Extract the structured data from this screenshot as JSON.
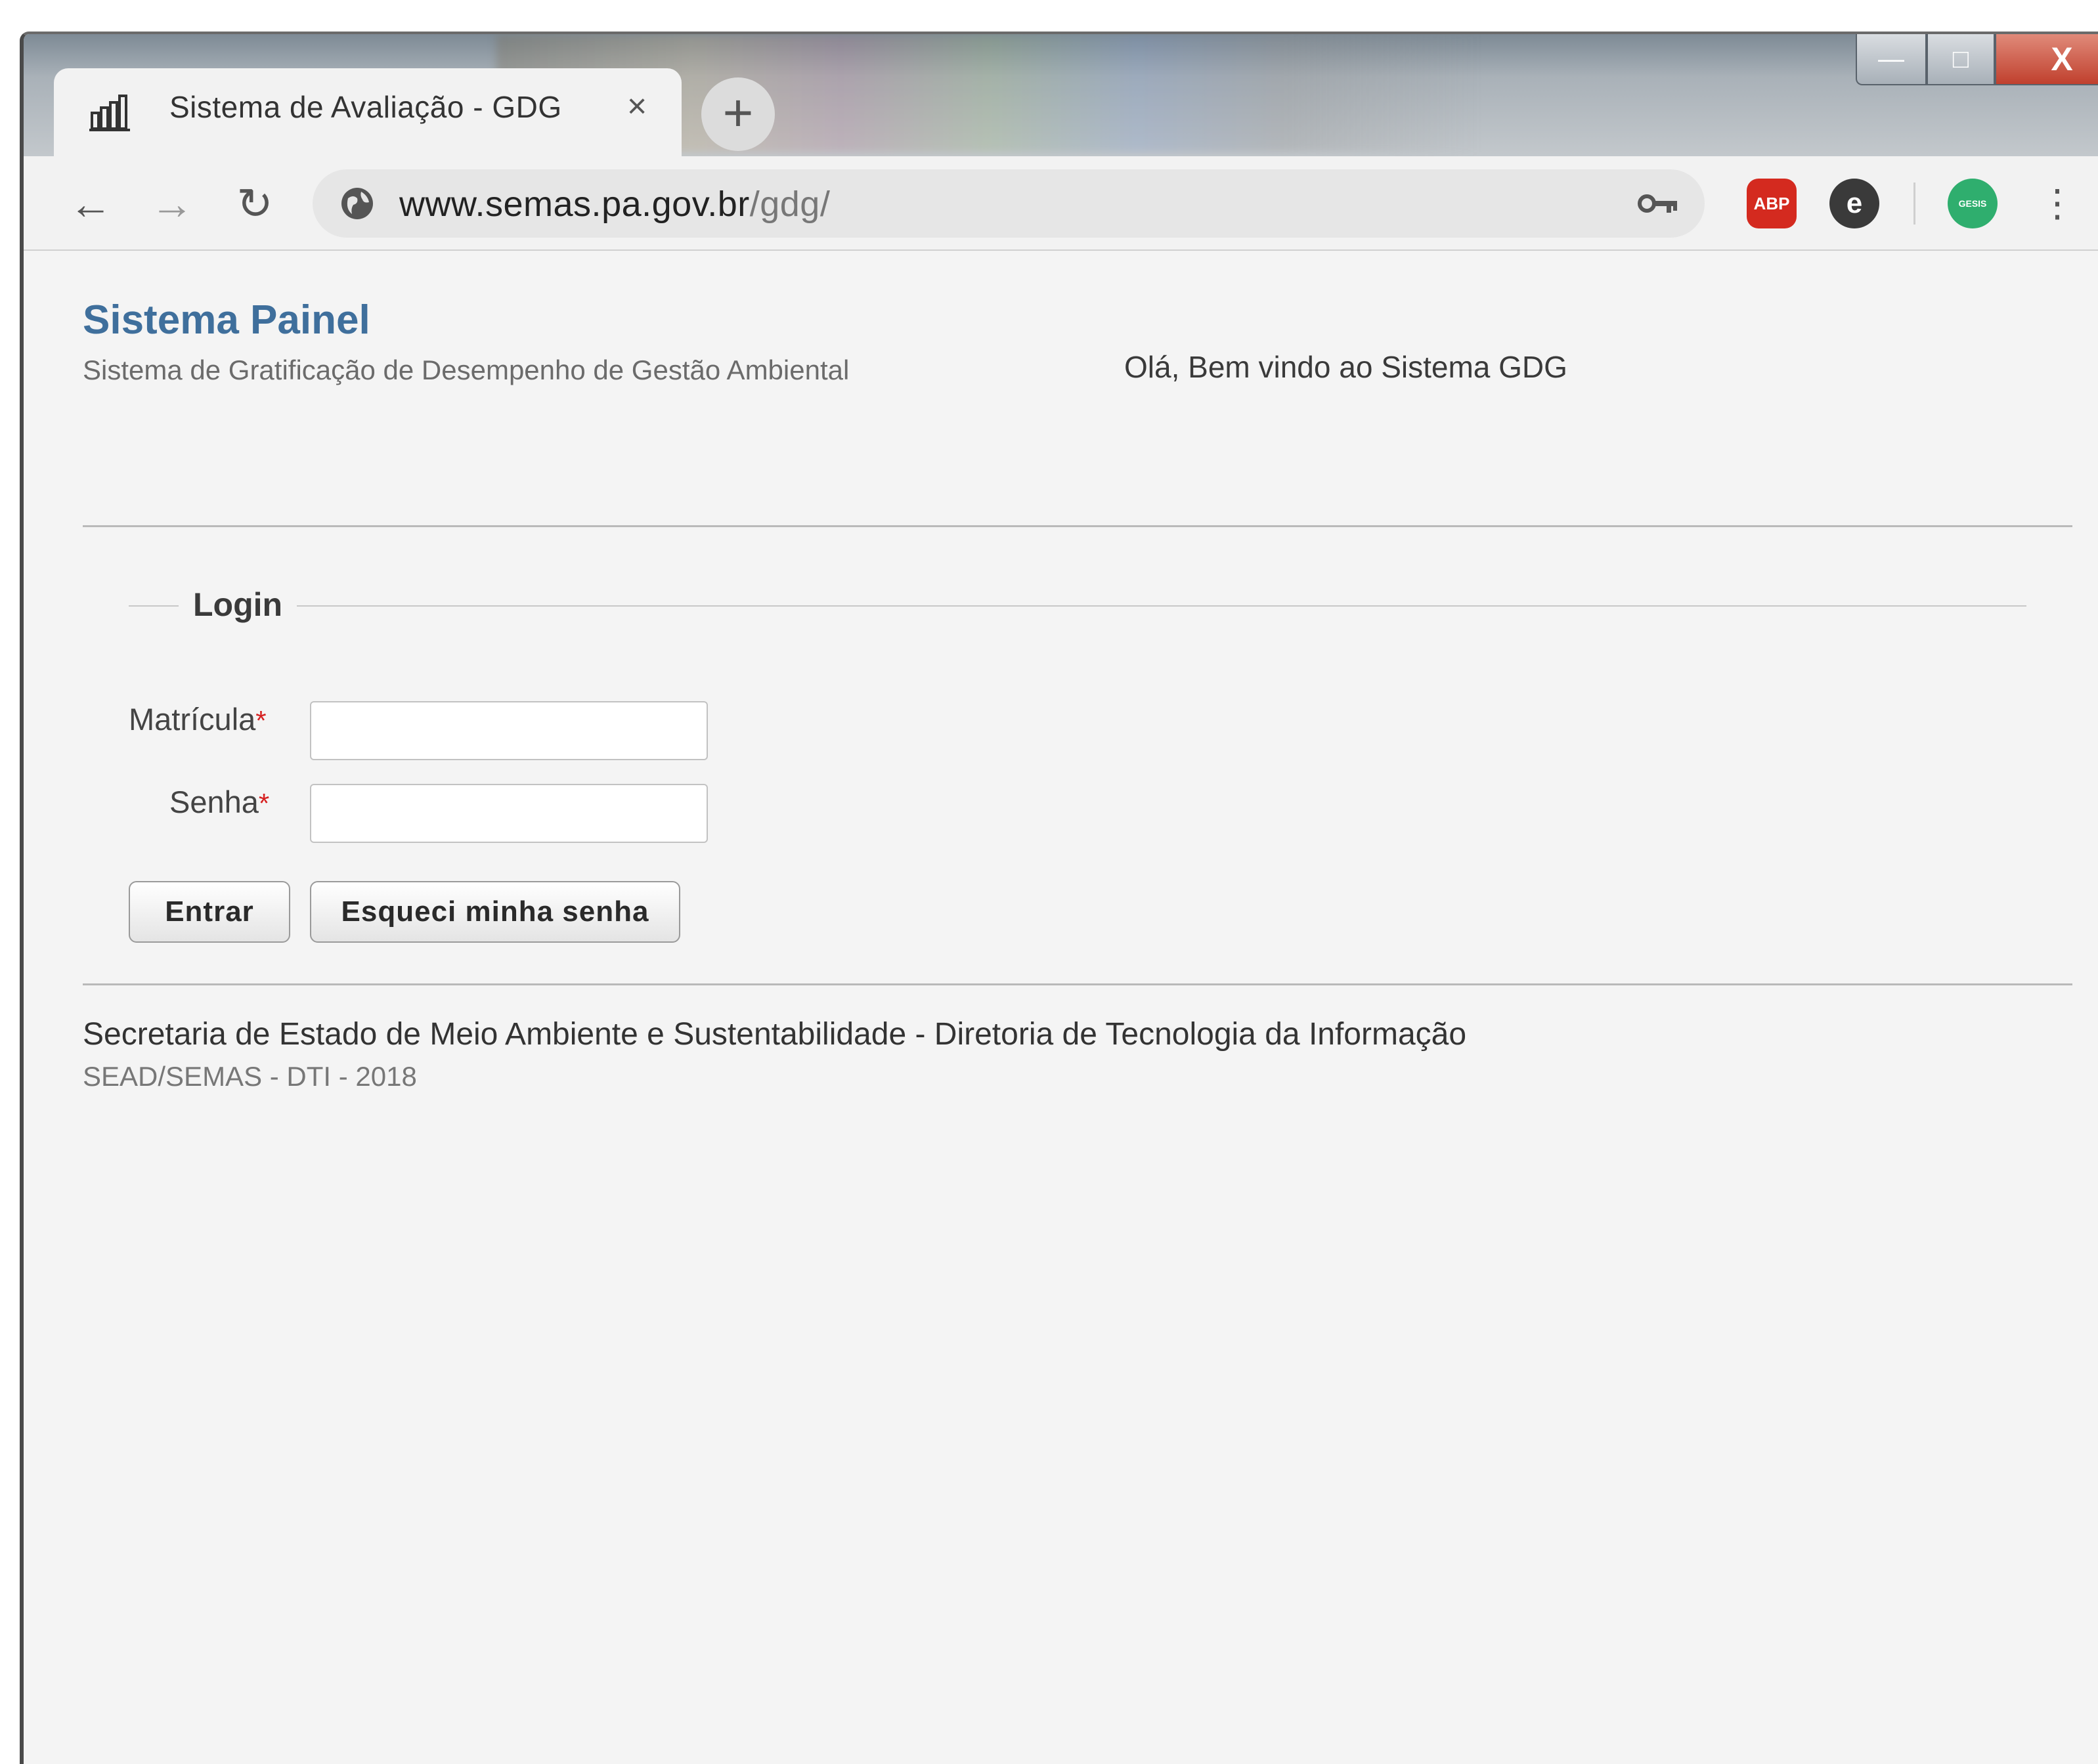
{
  "browser": {
    "tab_title": "Sistema de Avaliação - GDG",
    "tab_close": "×",
    "new_tab": "+",
    "url_host": "www.semas.pa.gov.br",
    "url_path": "/gdg/",
    "back": "←",
    "forward": "→",
    "reload": "↻",
    "menu": "⋮",
    "extensions": {
      "abp": "ABP",
      "ghostery": "e",
      "gesis": "GESIS"
    },
    "window_controls": {
      "minimize": "—",
      "maximize": "□",
      "close": "X"
    }
  },
  "header": {
    "title": "Sistema Painel",
    "subtitle": "Sistema de Gratificação de Desempenho de Gestão Ambiental",
    "welcome": "Olá, Bem vindo ao Sistema GDG"
  },
  "login": {
    "legend": "Login",
    "matricula_label": "Matrícula",
    "senha_label": "Senha",
    "required_mark": "*",
    "matricula_value": "",
    "senha_value": "",
    "submit_label": "Entrar",
    "forgot_label": "Esqueci minha senha"
  },
  "footer": {
    "line1": "Secretaria de Estado de Meio Ambiente e Sustentabilidade - Diretoria de Tecnologia da Informação",
    "line2": "SEAD/SEMAS - DTI - 2018"
  },
  "colors": {
    "title_blue": "#3f6f9c",
    "required_red": "#d62020",
    "page_bg": "#f4f4f4"
  }
}
